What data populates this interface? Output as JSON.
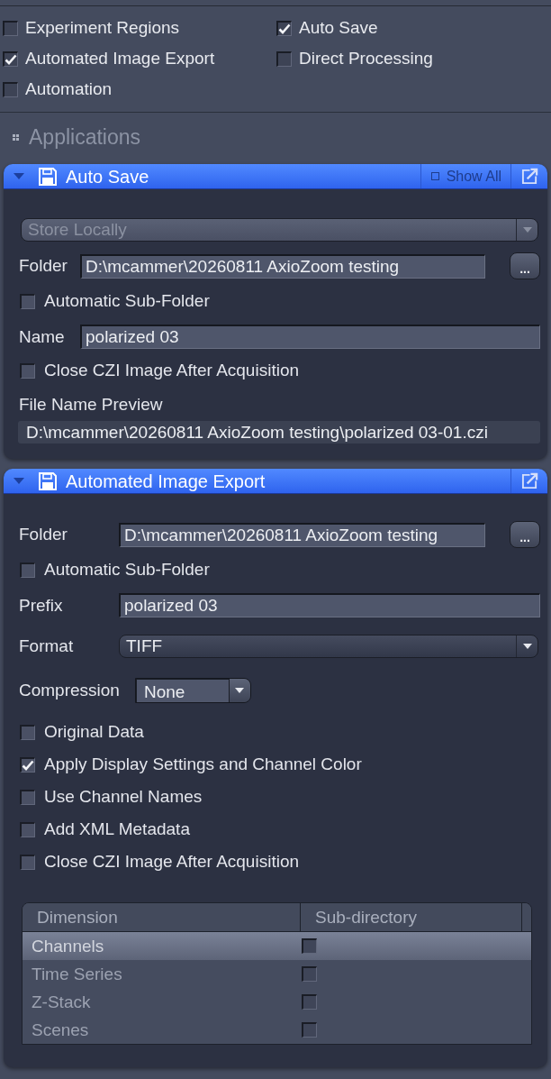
{
  "options": [
    {
      "label": "Experiment Regions",
      "checked": false
    },
    {
      "label": "Auto Save",
      "checked": true
    },
    {
      "label": "Automated Image Export",
      "checked": true
    },
    {
      "label": "Direct Processing",
      "checked": false
    },
    {
      "label": "Automation",
      "checked": false
    }
  ],
  "applications": {
    "title": "Applications"
  },
  "panels": [
    {
      "title": "Auto Save",
      "expanded": true,
      "show_all": "Show All",
      "rows": [
        {
          "kind": "select",
          "value": "Store Locally",
          "disabled": true
        },
        {
          "kind": "field",
          "label": "Folder",
          "value": "D:\\mcammer\\20260811 AxioZoom testing",
          "button": "..."
        },
        {
          "kind": "checkbox",
          "label": "Automatic Sub-Folder",
          "checked": false
        },
        {
          "kind": "field",
          "label": "Name",
          "value": "polarized 03"
        },
        {
          "kind": "checkbox",
          "label": "Close CZI Image After Acquisition",
          "checked": false
        },
        {
          "kind": "preview",
          "label": "File Name Preview",
          "value": "D:\\mcammer\\20260811 AxioZoom testing\\polarized 03-01.czi"
        }
      ]
    },
    {
      "title": "Automated Image Export",
      "expanded": true,
      "rows": [
        {
          "kind": "field",
          "label": "Folder",
          "value": "D:\\mcammer\\20260811 AxioZoom testing",
          "button": "..."
        },
        {
          "kind": "checkbox",
          "label": "Automatic Sub-Folder",
          "checked": false
        },
        {
          "kind": "field",
          "label": "Prefix",
          "value": "polarized 03"
        },
        {
          "kind": "select",
          "label": "Format",
          "value": "TIFF",
          "disabled": false
        },
        {
          "kind": "dropdown",
          "label": "Compression",
          "value": "None"
        },
        {
          "kind": "checkbox",
          "label": "Original Data",
          "checked": false
        },
        {
          "kind": "checkbox",
          "label": "Apply Display Settings and Channel Color",
          "checked": true
        },
        {
          "kind": "checkbox",
          "label": "Use Channel Names",
          "checked": false
        },
        {
          "kind": "checkbox",
          "label": "Add XML Metadata",
          "checked": false
        },
        {
          "kind": "checkbox",
          "label": "Close CZI Image After Acquisition",
          "checked": false
        },
        {
          "kind": "table",
          "columns": [
            "Dimension",
            "Sub-directory"
          ],
          "rows": [
            {
              "dimension": "Channels",
              "checked": false,
              "selected": true
            },
            {
              "dimension": "Time Series",
              "checked": false,
              "selected": false
            },
            {
              "dimension": "Z-Stack",
              "checked": false,
              "selected": false
            },
            {
              "dimension": "Scenes",
              "checked": false,
              "selected": false
            }
          ]
        }
      ]
    }
  ]
}
